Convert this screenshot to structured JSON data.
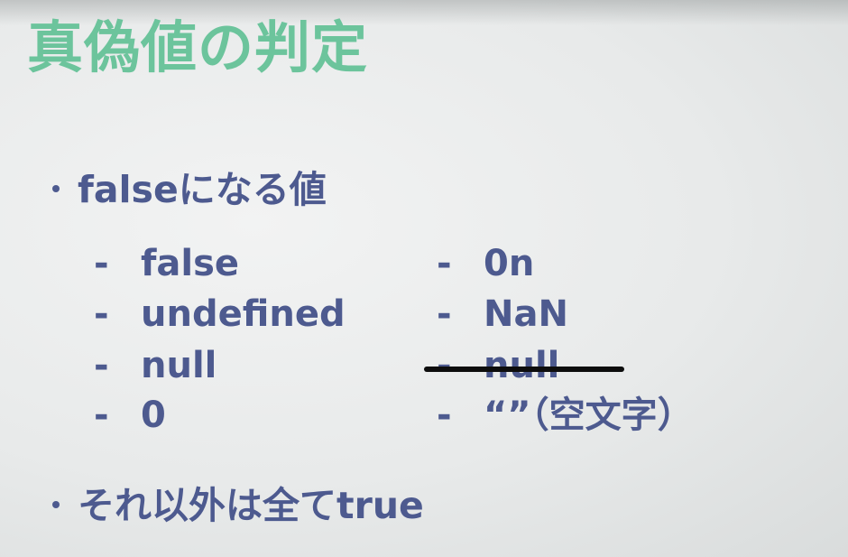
{
  "title": "真偽値の判定",
  "bullet1": {
    "text": "falseになる値",
    "left_column": [
      {
        "dash": "-",
        "value": "false"
      },
      {
        "dash": "-",
        "value": "undefined"
      },
      {
        "dash": "-",
        "value": "null"
      },
      {
        "dash": "-",
        "value": "0"
      }
    ],
    "right_column": [
      {
        "dash": "-",
        "value": "0n"
      },
      {
        "dash": "-",
        "value": "NaN"
      },
      {
        "dash": "-",
        "value": "null",
        "struck_through": true
      },
      {
        "dash": "-",
        "value": "“”（空文字）"
      }
    ]
  },
  "bullet2": {
    "text": "それ以外は全てtrue"
  },
  "colors": {
    "title": "#6cc49c",
    "text": "#4d5a8f",
    "strike": "#0d0d0d"
  }
}
